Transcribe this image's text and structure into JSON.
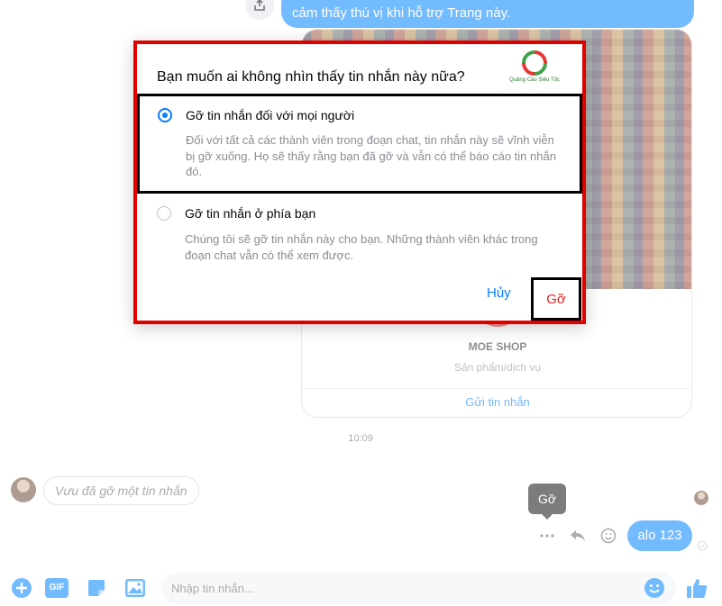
{
  "chat": {
    "top_message": "cảm thấy thú vị khi hỗ trợ Trang này.",
    "product": {
      "name": "MOE SHOP",
      "subtitle": "Sản phẩm/dịch vụ",
      "link": "Gửi tin nhắn"
    },
    "timestamp": "10:09",
    "removed_message": "Vưu đã gỡ một tin nhắn",
    "tooltip": "Gỡ",
    "own_message": "alo 123"
  },
  "composer": {
    "placeholder": "Nhập tin nhắn...",
    "gif_label": "GIF"
  },
  "dialog": {
    "title": "Bạn muốn ai không nhìn thấy tin nhắn này nữa?",
    "brand_text": "Quảng Cáo Siêu Tốc",
    "options": [
      {
        "label": "Gỡ tin nhắn đối với mọi người",
        "description": "Đối với tất cả các thành viên trong đoạn chat, tin nhắn này sẽ vĩnh viễn bị gỡ xuống. Họ sẽ thấy rằng bạn đã gỡ và vẫn có thể báo cáo tin nhắn đó.",
        "selected": true
      },
      {
        "label": "Gỡ tin nhắn ở phía bạn",
        "description": "Chúng tôi sẽ gỡ tin nhắn này cho bạn. Những thành viên khác trong đoạn chat vẫn có thể xem được.",
        "selected": false
      }
    ],
    "cancel_label": "Hủy",
    "remove_label": "Gỡ"
  },
  "colors": {
    "messenger_blue": "#0084ff",
    "link_blue": "#0a7cff",
    "remove_red": "#e4232a",
    "highlight_red": "#e00000"
  },
  "icons": [
    "share-icon",
    "more-icon",
    "reply-icon",
    "emoji-icon",
    "seen-icon",
    "plus-icon",
    "gif-icon",
    "sticker-icon",
    "image-icon",
    "smiley-icon",
    "like-icon"
  ]
}
